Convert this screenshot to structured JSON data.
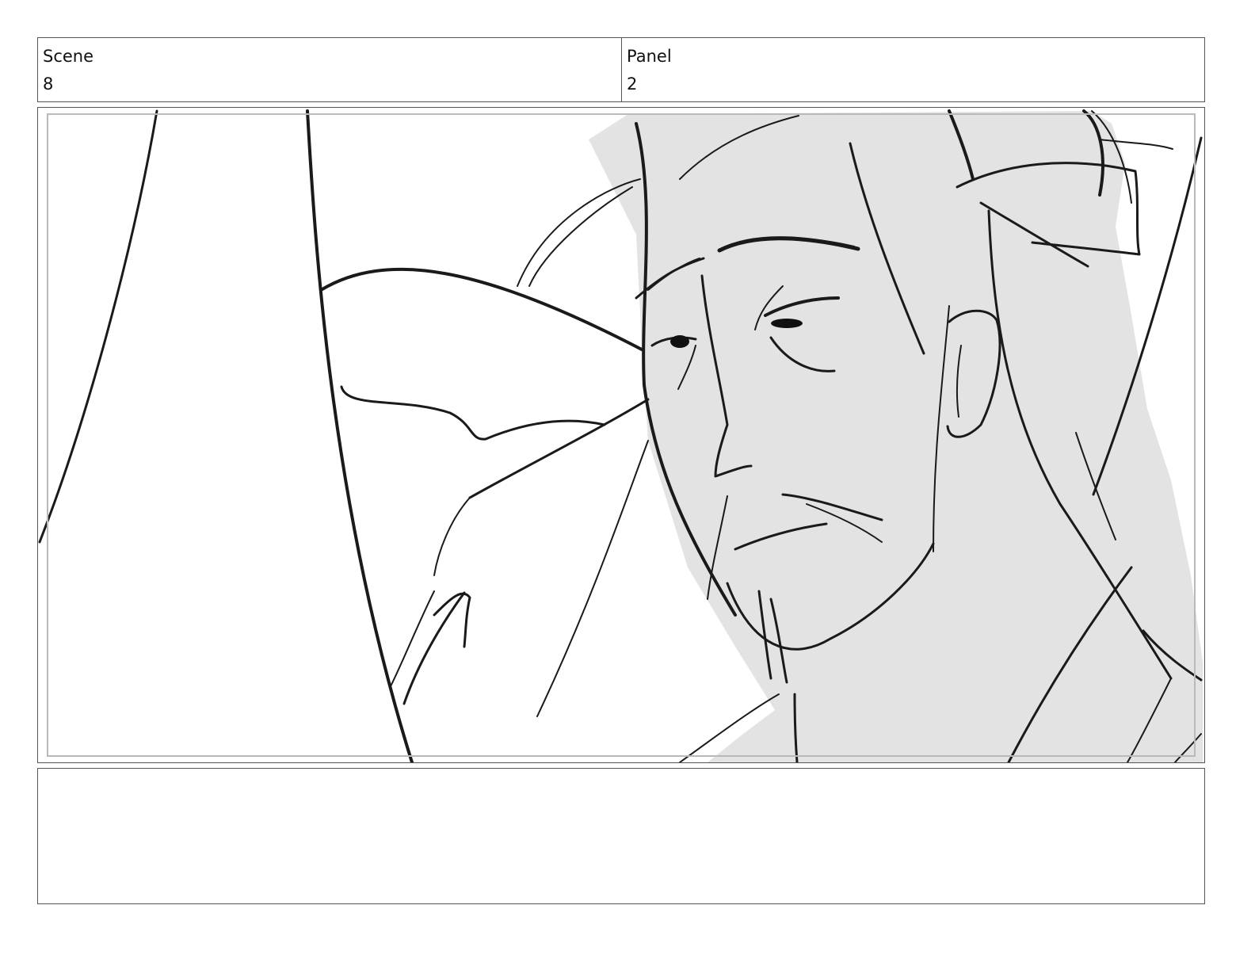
{
  "header": {
    "scene_label": "Scene",
    "scene_value": "8",
    "panel_label": "Panel",
    "panel_value": "2"
  },
  "notes": {
    "text": ""
  },
  "colors": {
    "frame_border": "#555555",
    "safe_area": "#b9b9b9",
    "shading": "#e3e3e3",
    "ink": "#1a1a1a"
  }
}
